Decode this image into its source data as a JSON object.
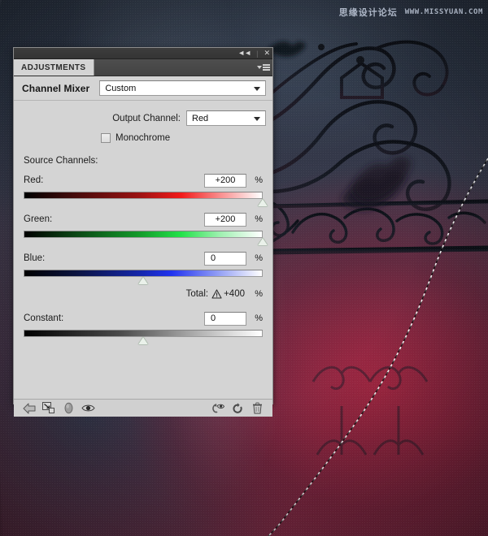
{
  "app": {
    "panel_tab": "ADJUSTMENTS",
    "adjustment_title": "Channel Mixer",
    "titlebar": {
      "collapse_icon": "collapse-double-left-icon",
      "separator": "|",
      "close_icon": "close-icon",
      "collapse_glyph": "◄◄",
      "close_glyph": "✕"
    },
    "menu_icon": "panel-menu-icon"
  },
  "preset": {
    "label": "Custom",
    "caret_icon": "chevron-down-icon"
  },
  "output_channel": {
    "label": "Output Channel:",
    "value": "Red",
    "caret_icon": "chevron-down-icon"
  },
  "monochrome": {
    "label": "Monochrome",
    "checked": false
  },
  "source_channels": {
    "title": "Source Channels:",
    "sliders": [
      {
        "name": "Red:",
        "value": "+200",
        "unit": "%",
        "thumb_pct": 100,
        "track": "red"
      },
      {
        "name": "Green:",
        "value": "+200",
        "unit": "%",
        "thumb_pct": 100,
        "track": "green"
      },
      {
        "name": "Blue:",
        "value": "0",
        "unit": "%",
        "thumb_pct": 50,
        "track": "blue"
      }
    ]
  },
  "total": {
    "label": "Total:",
    "warning_icon": "warning-triangle-icon",
    "value": "+400",
    "unit": "%"
  },
  "constant": {
    "name": "Constant:",
    "value": "0",
    "unit": "%",
    "thumb_pct": 50,
    "track": "gray"
  },
  "footer": {
    "icons": [
      {
        "name": "return-to-adjustment-list-icon",
        "title": "Return to adjustment list"
      },
      {
        "name": "clip-to-layer-icon",
        "title": "Clip to layer"
      },
      {
        "name": "preset-swatch-icon",
        "title": "Preset"
      },
      {
        "name": "toggle-layer-visibility-eye-icon",
        "title": "Toggle layer visibility"
      },
      {
        "name": "view-previous-state-icon",
        "title": "View previous state"
      },
      {
        "name": "reset-adjustment-icon",
        "title": "Reset to adjustment defaults"
      },
      {
        "name": "delete-adjustment-layer-trash-icon",
        "title": "Delete this adjustment layer"
      }
    ]
  },
  "watermark": {
    "chinese": "思缘设计论坛",
    "url": "WWW.MISSYUAN.COM"
  },
  "artwork": {
    "description": "gothic wrought-iron gate at night with bats and a white selection path",
    "colors": {
      "sky_top": "#2a3342",
      "crimson_bottom": "#8c3450",
      "iron": "#14161d",
      "selection_path": "#ffffff"
    }
  },
  "theme": {
    "panel_bg": "#d4d4d4",
    "panel_border": "#8d8d8d",
    "titlebar_bg": "#3d3d3d",
    "tabbar_bg": "#4e4e4e",
    "field_bg": "#ffffff",
    "thumb": "#5c8a5e"
  }
}
